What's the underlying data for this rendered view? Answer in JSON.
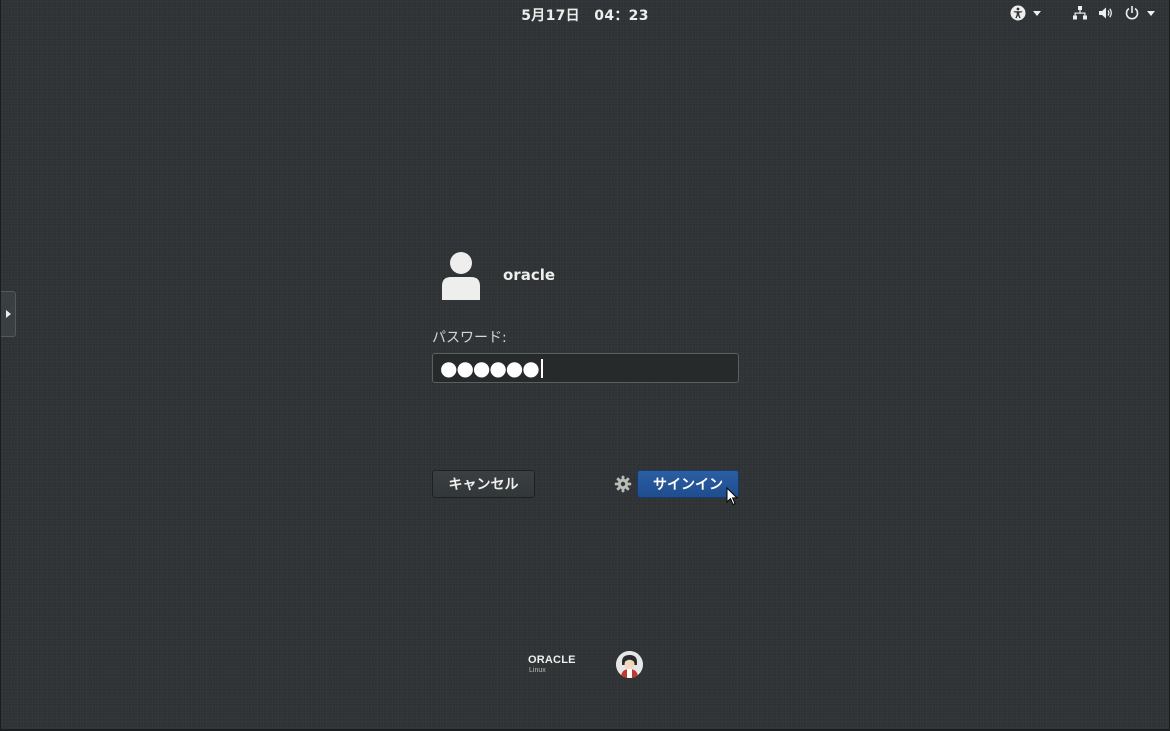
{
  "topbar": {
    "clock": "5月17日　04：23",
    "icons": {
      "accessibility": "accessibility-icon",
      "network": "network-icon",
      "volume": "volume-icon",
      "power": "power-icon"
    }
  },
  "login": {
    "user_name": "oracle",
    "password_label": "パスワード:",
    "password_mask": "●●●●●●",
    "cancel_label": "キャンセル",
    "signin_label": "サインイン"
  },
  "branding": {
    "logo_main": "ORACLE",
    "logo_sub": "Linux"
  },
  "colors": {
    "background": "#2f3335",
    "accent": "#1f4d8e",
    "text": "#eeeeec"
  }
}
